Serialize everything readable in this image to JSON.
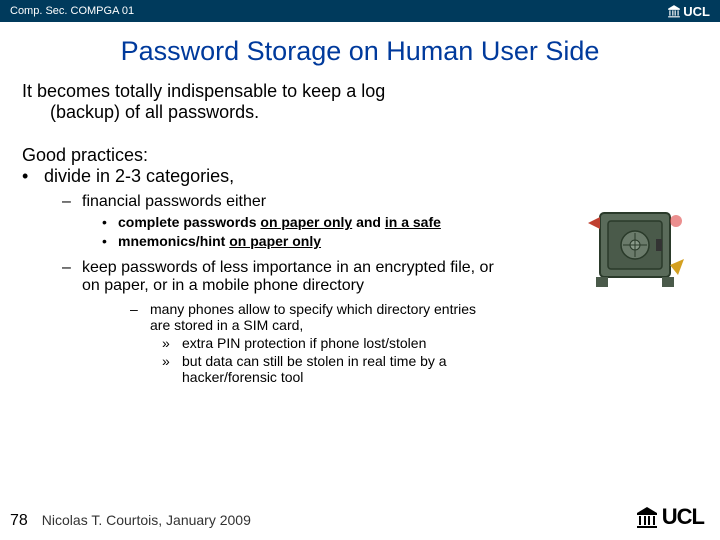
{
  "header": {
    "course": "Comp. Sec. COMPGA 01",
    "logo_text": "UCL"
  },
  "title": "Password Storage on Human User Side",
  "intro": {
    "line1": "It becomes totally indispensable to keep a log",
    "line2": "(backup) of all passwords."
  },
  "gp_heading": "Good practices:",
  "bullet_divide": "divide in 2-3 categories,",
  "dash_financial": "financial passwords either",
  "dot_complete_a": "complete passwords ",
  "dot_complete_b": "on paper only",
  "dot_complete_c": " and ",
  "dot_complete_d": "in a safe",
  "dot_mnem_a": "mnemonics/hint ",
  "dot_mnem_b": "on paper only",
  "dash_keep": "keep passwords of less importance in an encrypted file, or on paper, or in a mobile phone directory",
  "dash2_phones": "many phones allow to specify which directory entries are stored in a SIM card,",
  "chev_pin": "extra PIN protection if phone lost/stolen",
  "chev_hacker": "but data can still be stolen in real time by a hacker/forensic tool",
  "footer": {
    "page": "78",
    "author": "Nicolas T. Courtois, January 2009",
    "logo_text": "UCL"
  }
}
